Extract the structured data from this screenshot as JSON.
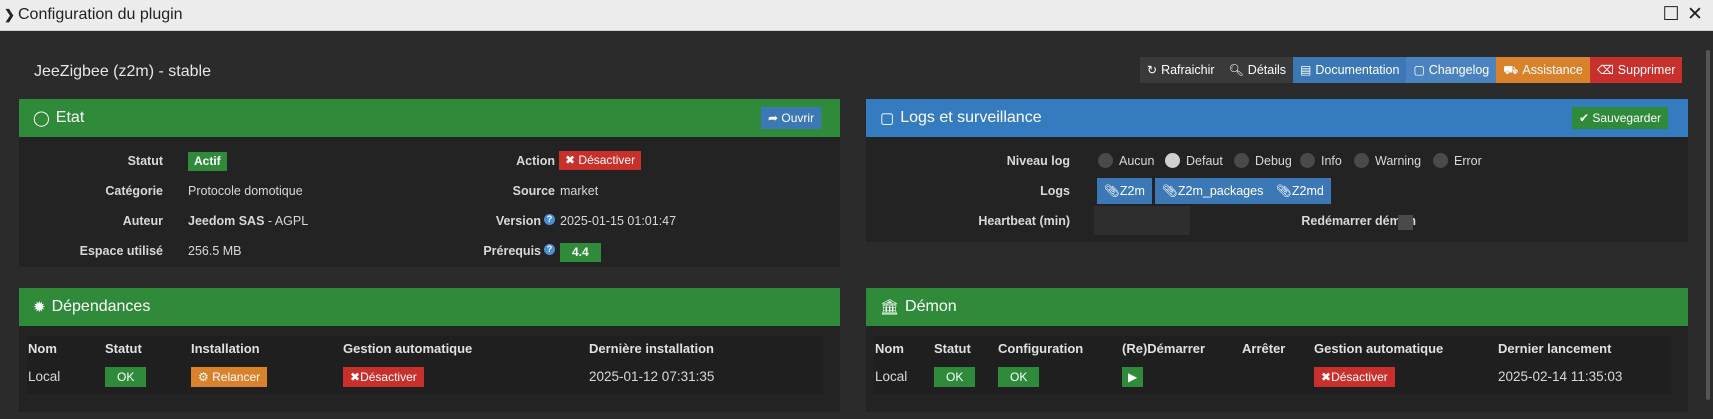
{
  "window": {
    "title": "Configuration du plugin"
  },
  "plugin": {
    "name": "JeeZigbee (z2m) - stable"
  },
  "toolbar": {
    "refresh": "Rafraichir",
    "details": "Détails",
    "documentation": "Documentation",
    "changelog": "Changelog",
    "assistance": "Assistance",
    "delete": "Supprimer"
  },
  "etat": {
    "title": "Etat",
    "open_label": "Ouvrir",
    "statut_label": "Statut",
    "statut_value": "Actif",
    "categorie_label": "Catégorie",
    "categorie_value": "Protocole domotique",
    "auteur_label": "Auteur",
    "auteur_name": "Jeedom SAS",
    "auteur_license": " - AGPL",
    "espace_label": "Espace utilisé",
    "espace_value": "256.5 MB",
    "action_label": "Action",
    "action_value": "Désactiver",
    "source_label": "Source",
    "source_value": "market",
    "version_label": "Version",
    "version_value": "2025-01-15 01:01:47",
    "prerequis_label": "Prérequis",
    "prerequis_value": "4.4"
  },
  "logs": {
    "title": "Logs et surveillance",
    "save_label": "Sauvegarder",
    "niveau_label": "Niveau log",
    "levels": [
      "Aucun",
      "Defaut",
      "Debug",
      "Info",
      "Warning",
      "Error"
    ],
    "selected_level": "Defaut",
    "logs_label": "Logs",
    "log_files": [
      "Z2m",
      "Z2m_packages",
      "Z2md"
    ],
    "heartbeat_label": "Heartbeat (min)",
    "heartbeat_value": "",
    "restart_label": "Redémarrer démon",
    "restart_checked": false
  },
  "dependances": {
    "title": "Dépendances",
    "headers": [
      "Nom",
      "Statut",
      "Installation",
      "Gestion automatique",
      "Dernière installation"
    ],
    "row": {
      "nom": "Local",
      "statut": "OK",
      "installation": "Relancer",
      "gestion": "Désactiver",
      "derniere": "2025-01-12 07:31:35"
    }
  },
  "demon": {
    "title": "Démon",
    "headers": [
      "Nom",
      "Statut",
      "Configuration",
      "(Re)Démarrer",
      "Arrêter",
      "Gestion automatique",
      "Dernier lancement"
    ],
    "row": {
      "nom": "Local",
      "statut": "OK",
      "configuration": "OK",
      "gestion": "Désactiver",
      "dernier": "2025-02-14 11:35:03"
    }
  },
  "colors": {
    "green": "#2f8b3a",
    "blue": "#357bbf",
    "red": "#c9302c",
    "orange": "#d9822b",
    "dark_btn": "#3a3a3a"
  }
}
